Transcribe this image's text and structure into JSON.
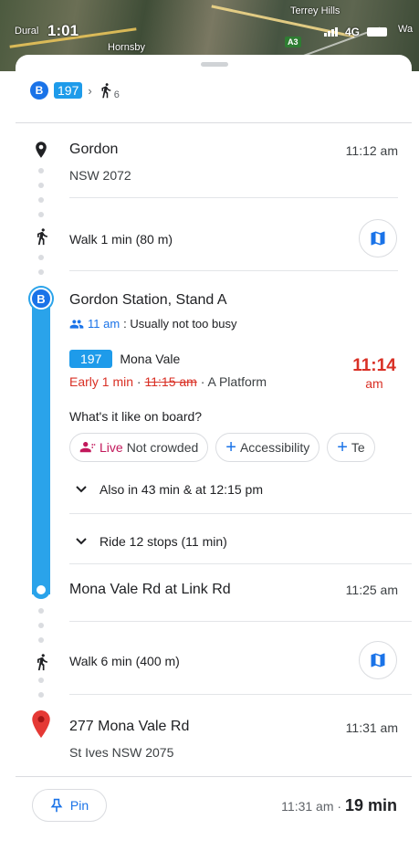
{
  "status_bar": {
    "time": "1:01",
    "network": "4G",
    "map_labels": [
      "Dural",
      "Hornsby",
      "Terrey Hills",
      "A3",
      "Wa"
    ]
  },
  "summary": {
    "bus_letter": "B",
    "route": "197",
    "walk_count": "6"
  },
  "segments": {
    "origin": {
      "title": "Gordon",
      "subtitle": "NSW 2072",
      "time": "11:12 am"
    },
    "walk1": {
      "label": "Walk 1 min (80 m)"
    },
    "boarding": {
      "stop": "Gordon Station, Stand A",
      "busy_time": "11 am",
      "busy_text": ": Usually not too busy",
      "route_chip": "197",
      "destination": "Mona Vale",
      "early": "Early 1 min",
      "sep1": " · ",
      "scheduled": "11:15 am",
      "sep2": " · ",
      "platform": "A Platform",
      "departure_time": "11:14",
      "departure_ampm": "am",
      "onboard_question": "What's it like on board?",
      "chips": {
        "live": "Live",
        "crowd": "Not crowded",
        "accessibility": "Accessibility",
        "third": "Te"
      },
      "also": "Also in 43 min & at 12:15 pm",
      "ride": "Ride 12 stops (11 min)"
    },
    "alight": {
      "title": "Mona Vale Rd at Link Rd",
      "time": "11:25 am"
    },
    "walk2": {
      "label": "Walk 6 min (400 m)"
    },
    "destination": {
      "title": "277 Mona Vale Rd",
      "subtitle": "St Ives NSW 2075",
      "time": "11:31 am"
    }
  },
  "bottom": {
    "pin_label": "Pin",
    "arrival": "11:31 am",
    "sep": " · ",
    "duration": "19 min"
  },
  "colors": {
    "accent_blue": "#1a73e8",
    "route_blue": "#1e9bea",
    "rail_blue": "#2aa3ea",
    "alert_red": "#d93025",
    "live_pink": "#c2185b"
  }
}
